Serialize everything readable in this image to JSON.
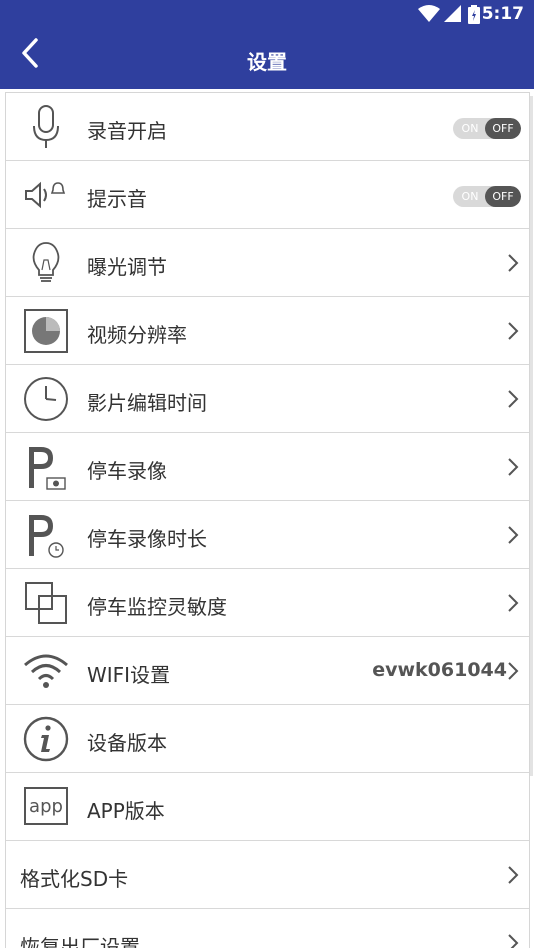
{
  "status_bar": {
    "time": "5:17",
    "icons": [
      "wifi-icon",
      "signal-icon",
      "battery-icon"
    ]
  },
  "header": {
    "title": "设置",
    "back_icon": "chevron-left-icon"
  },
  "colors": {
    "appbar": "#2f3f9e",
    "toggle_off_knob": "#555555",
    "toggle_track": "#d9d9d9"
  },
  "rows": [
    {
      "label": "录音开启",
      "icon": "microphone-icon",
      "toggle": {
        "on": "ON",
        "off": "OFF"
      }
    },
    {
      "label": "提示音",
      "icon": "speaker-bell-icon",
      "toggle": {
        "on": "ON",
        "off": "OFF"
      }
    },
    {
      "label": "曝光调节",
      "icon": "lightbulb-icon"
    },
    {
      "label": "视频分辨率",
      "icon": "resolution-icon"
    },
    {
      "label": "影片编辑时间",
      "icon": "clock-icon"
    },
    {
      "label": "停车录像",
      "icon": "parking-camera-icon"
    },
    {
      "label": "停车录像时长",
      "icon": "parking-clock-icon"
    },
    {
      "label": "停车监控灵敏度",
      "icon": "overlap-squares-icon"
    },
    {
      "label": "WIFI设置",
      "icon": "wifi-icon",
      "value": "evwk061044"
    },
    {
      "label": "设备版本",
      "icon": "info-icon"
    },
    {
      "label": "APP版本",
      "icon": "app-icon",
      "icon_text": "app"
    },
    {
      "label": "格式化SD卡"
    },
    {
      "label": "恢复出厂设置"
    }
  ]
}
